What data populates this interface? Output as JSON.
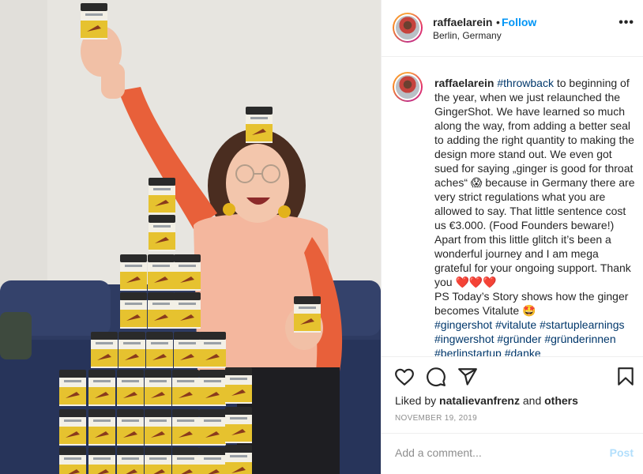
{
  "post": {
    "photo_alt": "Woman holding jars of GingerShot stacked in a pyramid",
    "photo_colors": {
      "wall": "#e6e4df",
      "sofa": "#2c3a5f",
      "sleeve": "#e8603a",
      "top": "#f4b79e",
      "jar_lid": "#2a2a2a",
      "jar_label": "#e6c22f"
    }
  },
  "header": {
    "username": "raffaelarein",
    "separator": "•",
    "follow_label": "Follow",
    "location": "Berlin, Germany",
    "more_label": "•••"
  },
  "caption": {
    "username": "raffaelarein",
    "hashtag_throwback": "#throwback",
    "text_1": " to beginning of the year, when we just relaunched the GingerShot. We have learned so much along the way, from adding a better seal to adding the right quantity to making the design more stand out. We even got sued for saying „ginger is good for throat aches“ 😱 because in Germany there are very strict regulations what you are allowed to say. That little sentence cost us €3.000. (Food Founders beware!) Apart from this little glitch it’s been a wonderful journey and I am mega grateful for your ongoing support. Thank you ❤️❤️❤️",
    "text_2": "PS Today’s Story shows how the ginger becomes Vitalute 🤩",
    "hashtags": [
      "#gingershot",
      "#vitalute",
      "#startuplearnings",
      "#ingwershot",
      "#gründer",
      "#gründerinnen",
      "#berlinstartup",
      "#danke"
    ]
  },
  "actions": {
    "icons": [
      "heart-icon",
      "comment-icon",
      "share-icon",
      "bookmark-icon"
    ],
    "liked_by_prefix": "Liked by ",
    "liked_by_user": "natalievanfrenz",
    "liked_by_and": " and ",
    "liked_by_others": "others",
    "date": "NOVEMBER 19, 2019"
  },
  "comment_box": {
    "placeholder": "Add a comment...",
    "post_label": "Post"
  }
}
